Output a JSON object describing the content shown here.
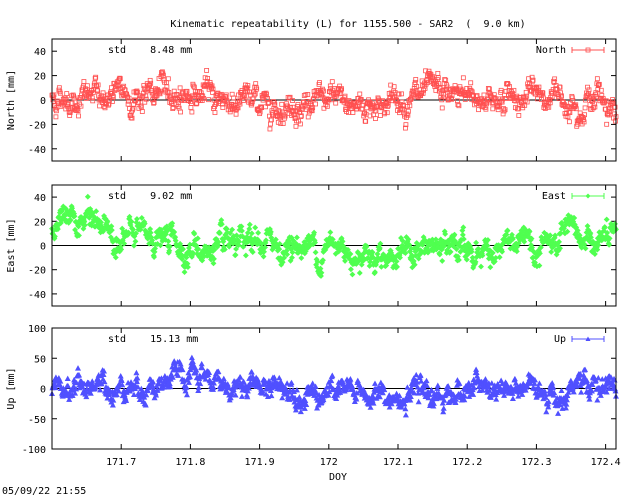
{
  "footer": {
    "timestamp": "05/09/22 21:55"
  },
  "chart_data": [
    {
      "type": "scatter",
      "title": "Kinematic repeatability (L) for 1155.500 - SAR2  (  9.0 km)",
      "ylabel": "North [mm]",
      "xlabel": "",
      "ylim": [
        -50,
        50
      ],
      "yticks": [
        -40,
        -20,
        0,
        20,
        40
      ],
      "xlim": [
        171.6,
        172.415
      ],
      "annotation": "std    8.48 mm",
      "series": [
        {
          "name": "North",
          "color": "#ff5050",
          "marker": "square",
          "amplitude": 8.48,
          "trend": [
            [
              171.6,
              2
            ],
            [
              171.7,
              3
            ],
            [
              171.8,
              6
            ],
            [
              171.85,
              1
            ],
            [
              171.9,
              -2
            ],
            [
              172.0,
              -3
            ],
            [
              172.05,
              -4
            ],
            [
              172.1,
              1
            ],
            [
              172.2,
              2
            ],
            [
              172.3,
              3
            ],
            [
              172.4,
              2
            ],
            [
              172.415,
              -10
            ]
          ]
        }
      ]
    },
    {
      "type": "scatter",
      "title": "",
      "ylabel": "East [mm]",
      "xlabel": "",
      "ylim": [
        -50,
        50
      ],
      "yticks": [
        -40,
        -20,
        0,
        20,
        40
      ],
      "xlim": [
        171.6,
        172.415
      ],
      "annotation": "std    9.02 mm",
      "series": [
        {
          "name": "East",
          "color": "#50ff50",
          "marker": "diamond",
          "amplitude": 9.02,
          "trend": [
            [
              171.6,
              14
            ],
            [
              171.65,
              20
            ],
            [
              171.68,
              14
            ],
            [
              171.7,
              8
            ],
            [
              171.75,
              7
            ],
            [
              171.8,
              -3
            ],
            [
              171.87,
              -8
            ],
            [
              171.9,
              1
            ],
            [
              172.0,
              -2
            ],
            [
              172.1,
              -6
            ],
            [
              172.2,
              -3
            ],
            [
              172.3,
              -2
            ],
            [
              172.4,
              5
            ],
            [
              172.415,
              0
            ]
          ]
        }
      ]
    },
    {
      "type": "scatter",
      "title": "",
      "ylabel": "Up [mm]",
      "xlabel": "DOY",
      "ylim": [
        -100,
        100
      ],
      "yticks": [
        -100,
        -50,
        0,
        50,
        100
      ],
      "xlim": [
        171.6,
        172.415
      ],
      "xticks": [
        171.7,
        171.8,
        171.9,
        172,
        172.1,
        172.2,
        172.3,
        172.4
      ],
      "xticklabels": [
        "171.7",
        "171.8",
        "171.9",
        "172",
        "172.1",
        "172.2",
        "172.3",
        "172.4"
      ],
      "annotation": "std    15.13 mm",
      "series": [
        {
          "name": "Up",
          "color": "#5050ff",
          "marker": "triangle",
          "amplitude": 15.13,
          "trend": [
            [
              171.6,
              0
            ],
            [
              171.7,
              5
            ],
            [
              171.8,
              12
            ],
            [
              171.9,
              5
            ],
            [
              172.0,
              0
            ],
            [
              172.1,
              -20
            ],
            [
              172.2,
              -2
            ],
            [
              172.3,
              -5
            ],
            [
              172.4,
              5
            ],
            [
              172.415,
              0
            ]
          ]
        }
      ]
    }
  ]
}
